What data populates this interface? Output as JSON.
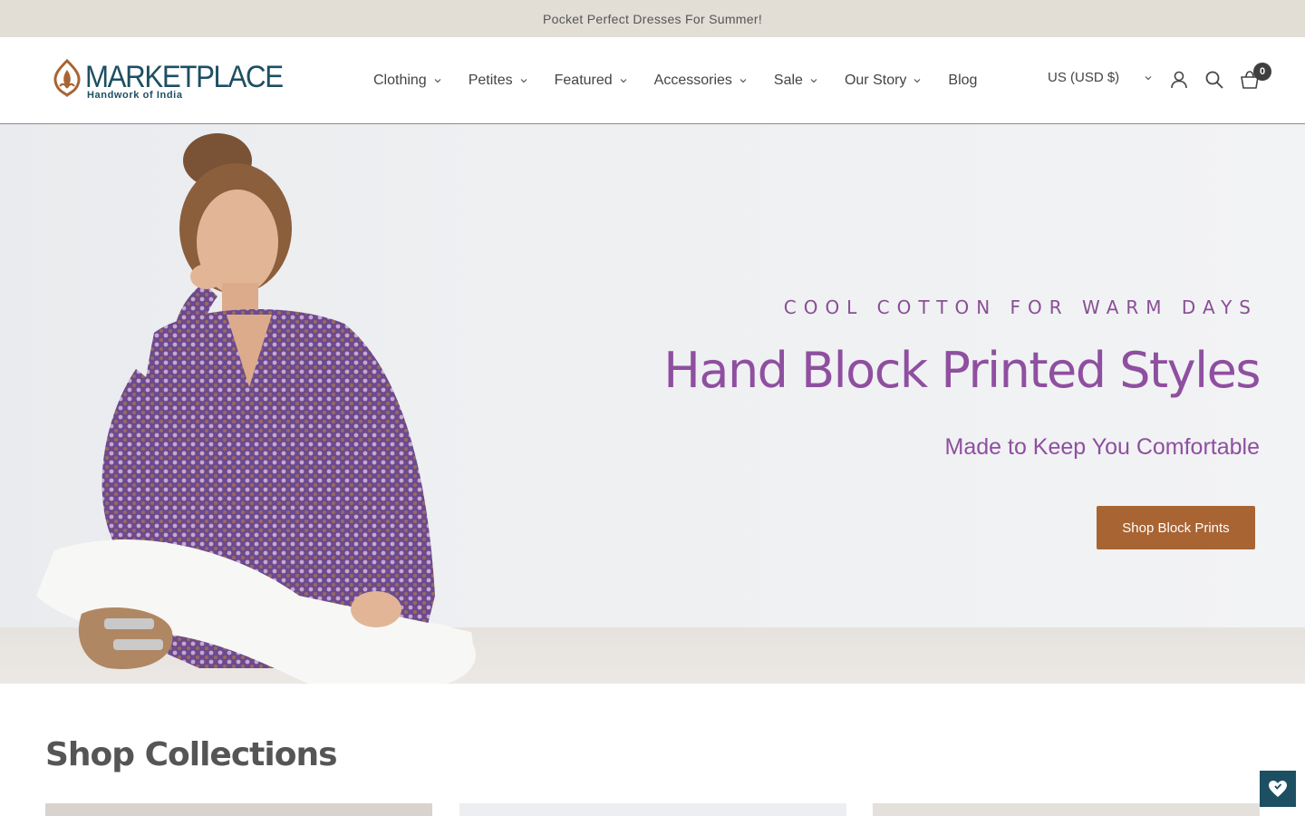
{
  "announcement": {
    "text": "Pocket Perfect Dresses For Summer!"
  },
  "header": {
    "logo": {
      "title": "MARKETPLACE",
      "subtitle": "Handwork of India"
    },
    "nav": [
      {
        "label": "Clothing",
        "has_dropdown": true
      },
      {
        "label": "Petites",
        "has_dropdown": true
      },
      {
        "label": "Featured",
        "has_dropdown": true
      },
      {
        "label": "Accessories",
        "has_dropdown": true
      },
      {
        "label": "Sale",
        "has_dropdown": true
      },
      {
        "label": "Our Story",
        "has_dropdown": true
      },
      {
        "label": "Blog",
        "has_dropdown": false
      }
    ],
    "currency": "US (USD $)",
    "cart_count": "0",
    "icons": [
      "account-icon",
      "search-icon",
      "cart-icon"
    ]
  },
  "hero": {
    "eyebrow": "COOL COTTON FOR WARM DAYS",
    "title": "Hand Block Printed Styles",
    "subtitle": "Made to Keep You Comfortable",
    "button_label": "Shop Block Prints"
  },
  "collections": {
    "title": "Shop Collections"
  },
  "colors": {
    "brand": "#1d4f63",
    "accent": "#a86433",
    "hero_text": "#8f4fa0",
    "announcement_bg": "#e2ded6"
  }
}
